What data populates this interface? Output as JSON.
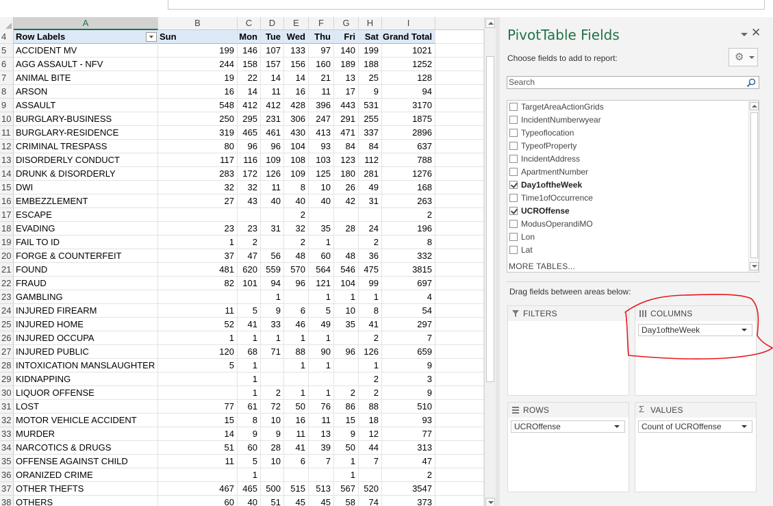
{
  "sheet": {
    "columns": [
      {
        "letter": "A",
        "selected": true
      },
      {
        "letter": "B",
        "selected": false
      },
      {
        "letter": "C",
        "selected": false
      },
      {
        "letter": "D",
        "selected": false
      },
      {
        "letter": "E",
        "selected": false
      },
      {
        "letter": "F",
        "selected": false
      },
      {
        "letter": "G",
        "selected": false
      },
      {
        "letter": "H",
        "selected": false
      },
      {
        "letter": "I",
        "selected": false
      }
    ],
    "header": {
      "row_number": "4",
      "cells": [
        "Row Labels",
        "Sun",
        "Mon",
        "Tue",
        "Wed",
        "Thu",
        "Fri",
        "Sat",
        "Grand Total"
      ]
    },
    "rows": [
      {
        "n": "5",
        "label": "ACCIDENT MV",
        "v": [
          "199",
          "146",
          "107",
          "133",
          "97",
          "140",
          "199",
          "1021"
        ]
      },
      {
        "n": "6",
        "label": "AGG ASSAULT - NFV",
        "v": [
          "244",
          "158",
          "157",
          "156",
          "160",
          "189",
          "188",
          "1252"
        ]
      },
      {
        "n": "7",
        "label": "ANIMAL BITE",
        "v": [
          "19",
          "22",
          "14",
          "14",
          "21",
          "13",
          "25",
          "128"
        ]
      },
      {
        "n": "8",
        "label": "ARSON",
        "v": [
          "16",
          "14",
          "11",
          "16",
          "11",
          "17",
          "9",
          "94"
        ]
      },
      {
        "n": "9",
        "label": "ASSAULT",
        "v": [
          "548",
          "412",
          "412",
          "428",
          "396",
          "443",
          "531",
          "3170"
        ]
      },
      {
        "n": "10",
        "label": "BURGLARY-BUSINESS",
        "v": [
          "250",
          "295",
          "231",
          "306",
          "247",
          "291",
          "255",
          "1875"
        ]
      },
      {
        "n": "11",
        "label": "BURGLARY-RESIDENCE",
        "v": [
          "319",
          "465",
          "461",
          "430",
          "413",
          "471",
          "337",
          "2896"
        ]
      },
      {
        "n": "12",
        "label": "CRIMINAL TRESPASS",
        "v": [
          "80",
          "96",
          "96",
          "104",
          "93",
          "84",
          "84",
          "637"
        ]
      },
      {
        "n": "13",
        "label": "DISORDERLY CONDUCT",
        "v": [
          "117",
          "116",
          "109",
          "108",
          "103",
          "123",
          "112",
          "788"
        ]
      },
      {
        "n": "14",
        "label": "DRUNK & DISORDERLY",
        "v": [
          "283",
          "172",
          "126",
          "109",
          "125",
          "180",
          "281",
          "1276"
        ]
      },
      {
        "n": "15",
        "label": "DWI",
        "v": [
          "32",
          "32",
          "11",
          "8",
          "10",
          "26",
          "49",
          "168"
        ]
      },
      {
        "n": "16",
        "label": "EMBEZZLEMENT",
        "v": [
          "27",
          "43",
          "40",
          "40",
          "40",
          "42",
          "31",
          "263"
        ]
      },
      {
        "n": "17",
        "label": "ESCAPE",
        "v": [
          "",
          "",
          "",
          "2",
          "",
          "",
          "",
          "2"
        ]
      },
      {
        "n": "18",
        "label": "EVADING",
        "v": [
          "23",
          "23",
          "31",
          "32",
          "35",
          "28",
          "24",
          "196"
        ]
      },
      {
        "n": "19",
        "label": "FAIL TO ID",
        "v": [
          "1",
          "2",
          "",
          "2",
          "1",
          "",
          "2",
          "8"
        ]
      },
      {
        "n": "20",
        "label": "FORGE & COUNTERFEIT",
        "v": [
          "37",
          "47",
          "56",
          "48",
          "60",
          "48",
          "36",
          "332"
        ]
      },
      {
        "n": "21",
        "label": "FOUND",
        "v": [
          "481",
          "620",
          "559",
          "570",
          "564",
          "546",
          "475",
          "3815"
        ]
      },
      {
        "n": "22",
        "label": "FRAUD",
        "v": [
          "82",
          "101",
          "94",
          "96",
          "121",
          "104",
          "99",
          "697"
        ]
      },
      {
        "n": "23",
        "label": "GAMBLING",
        "v": [
          "",
          "",
          "1",
          "",
          "1",
          "1",
          "1",
          "4"
        ]
      },
      {
        "n": "24",
        "label": "INJURED FIREARM",
        "v": [
          "11",
          "5",
          "9",
          "6",
          "5",
          "10",
          "8",
          "54"
        ]
      },
      {
        "n": "25",
        "label": "INJURED HOME",
        "v": [
          "52",
          "41",
          "33",
          "46",
          "49",
          "35",
          "41",
          "297"
        ]
      },
      {
        "n": "26",
        "label": "INJURED OCCUPA",
        "v": [
          "1",
          "1",
          "1",
          "1",
          "1",
          "",
          "2",
          "7"
        ]
      },
      {
        "n": "27",
        "label": "INJURED PUBLIC",
        "v": [
          "120",
          "68",
          "71",
          "88",
          "90",
          "96",
          "126",
          "659"
        ]
      },
      {
        "n": "28",
        "label": "INTOXICATION MANSLAUGHTER",
        "v": [
          "5",
          "1",
          "",
          "1",
          "1",
          "",
          "1",
          "9"
        ]
      },
      {
        "n": "29",
        "label": "KIDNAPPING",
        "v": [
          "",
          "1",
          "",
          "",
          "",
          "",
          "2",
          "3"
        ]
      },
      {
        "n": "30",
        "label": "LIQUOR OFFENSE",
        "v": [
          "",
          "1",
          "2",
          "1",
          "1",
          "2",
          "2",
          "9"
        ]
      },
      {
        "n": "31",
        "label": "LOST",
        "v": [
          "77",
          "61",
          "72",
          "50",
          "76",
          "86",
          "88",
          "510"
        ]
      },
      {
        "n": "32",
        "label": "MOTOR VEHICLE ACCIDENT",
        "v": [
          "15",
          "8",
          "10",
          "16",
          "11",
          "15",
          "18",
          "93"
        ]
      },
      {
        "n": "33",
        "label": "MURDER",
        "v": [
          "14",
          "9",
          "9",
          "11",
          "13",
          "9",
          "12",
          "77"
        ]
      },
      {
        "n": "34",
        "label": "NARCOTICS & DRUGS",
        "v": [
          "51",
          "60",
          "28",
          "41",
          "39",
          "50",
          "44",
          "313"
        ]
      },
      {
        "n": "35",
        "label": "OFFENSE AGAINST CHILD",
        "v": [
          "11",
          "5",
          "10",
          "6",
          "7",
          "1",
          "7",
          "47"
        ]
      },
      {
        "n": "36",
        "label": "ORANIZED CRIME",
        "v": [
          "",
          "1",
          "",
          "",
          "",
          "1",
          "",
          "2"
        ]
      },
      {
        "n": "37",
        "label": "OTHER THEFTS",
        "v": [
          "467",
          "465",
          "500",
          "515",
          "513",
          "567",
          "520",
          "3547"
        ]
      },
      {
        "n": "38",
        "label": "OTHERS",
        "v": [
          "60",
          "40",
          "51",
          "45",
          "45",
          "58",
          "74",
          "373"
        ]
      }
    ]
  },
  "pivot": {
    "title": "PivotTable Fields",
    "close_glyph": "✕",
    "gear_glyph": "⚙",
    "choose_label": "Choose fields to add to report:",
    "search_placeholder": "Search",
    "fields": [
      {
        "label": "TargetAreaActionGrids",
        "checked": false
      },
      {
        "label": "IncidentNumberwyear",
        "checked": false
      },
      {
        "label": "Typeoflocation",
        "checked": false
      },
      {
        "label": "TypeofProperty",
        "checked": false
      },
      {
        "label": "IncidentAddress",
        "checked": false
      },
      {
        "label": "ApartmentNumber",
        "checked": false
      },
      {
        "label": "Day1oftheWeek",
        "checked": true
      },
      {
        "label": "Time1ofOccurrence",
        "checked": false
      },
      {
        "label": "UCROffense",
        "checked": true
      },
      {
        "label": "ModusOperandiMO",
        "checked": false
      },
      {
        "label": "Lon",
        "checked": false
      },
      {
        "label": "Lat",
        "checked": false
      }
    ],
    "more_tables": "MORE TABLES...",
    "drag_label": "Drag fields between areas below:",
    "areas": {
      "filters": {
        "label": "FILTERS",
        "icon": "filter-icon",
        "field": ""
      },
      "columns": {
        "label": "COLUMNS",
        "icon": "columns-icon",
        "field": "Day1oftheWeek"
      },
      "rows": {
        "label": "ROWS",
        "icon": "rows-icon",
        "field": "UCROffense"
      },
      "values": {
        "label": "VALUES",
        "icon": "sigma-icon",
        "field": "Count of UCROffense"
      }
    }
  },
  "colors": {
    "accent": "#217346",
    "header_fill": "#dde9f6",
    "annotation": "#e8161b"
  }
}
